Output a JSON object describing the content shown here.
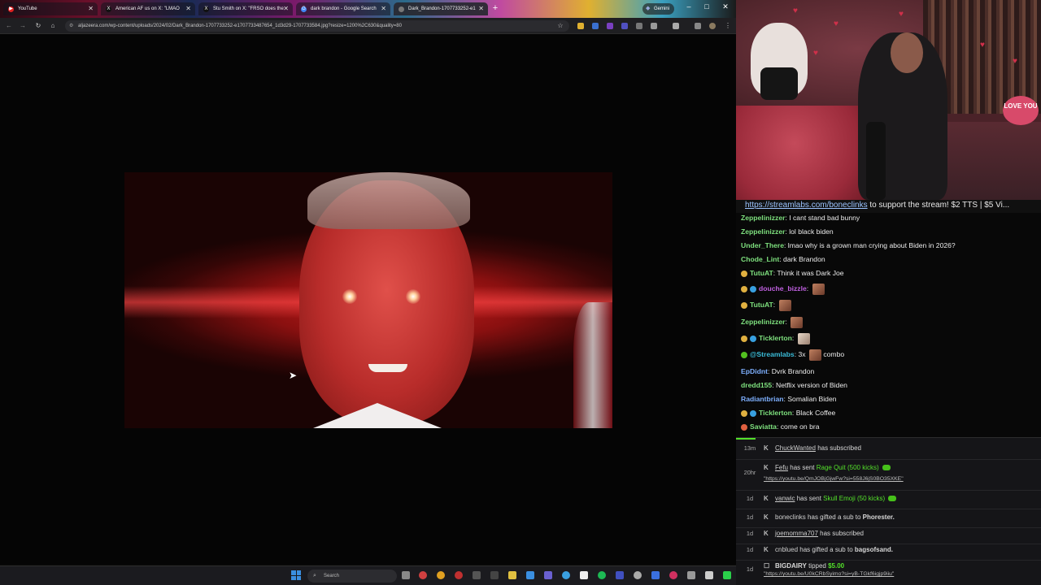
{
  "browser": {
    "tabs": [
      {
        "label": "YouTube",
        "icon": "youtube-icon",
        "color": "#e02020"
      },
      {
        "label": "American AF us on X: \"LMAO",
        "icon": "x-icon",
        "color": "#000000"
      },
      {
        "label": "Stu Smith on X: \"FRSO does the",
        "icon": "x-icon",
        "color": "#000000"
      },
      {
        "label": "dark brandon - Google Search",
        "icon": "google-icon",
        "color": "#4285f4"
      },
      {
        "label": "Dark_Brandon-1707733252-e1",
        "icon": "image-icon",
        "color": "#888888"
      }
    ],
    "new_tab": "+",
    "gemini": "Gemini",
    "win_controls": [
      "–",
      "□",
      "✕"
    ],
    "url": "aljazeera.com/wp-content/uploads/2024/02/Dark_Brandon-1707733252-e1707733487654_1d3d29-1707733584.jpg?resize=1200%2C630&quality=80",
    "nav": [
      "←",
      "→",
      "↻",
      "⌂"
    ],
    "star": "☆"
  },
  "taskbar": {
    "search_placeholder": "Search"
  },
  "webcam": {
    "sign_text": "LOVE YOU"
  },
  "banner": {
    "link": "https://streamlabs.com/boneclinks",
    "text": " to support the stream! $2 TTS | $5 Vi..."
  },
  "chat": [
    {
      "user": "Zeppelinizzer",
      "color": "#7ee07e",
      "text": "I cant stand bad bunny",
      "badges": []
    },
    {
      "user": "Zeppelinizzer",
      "color": "#7ee07e",
      "text": "lol black biden",
      "badges": []
    },
    {
      "user": "Under_There",
      "color": "#7ee07e",
      "text": "lmao why is a grown man crying about Biden in 2026?",
      "badges": []
    },
    {
      "user": "Chode_Lint",
      "color": "#7ee07e",
      "text": "dark Brandon",
      "badges": []
    },
    {
      "user": "TutuAT",
      "color": "#7ee07e",
      "text": "Think it was Dark Joe",
      "badges": [
        "#e0b040"
      ]
    },
    {
      "user": "douche_bizzle",
      "color": "#c060e0",
      "text": "",
      "badges": [
        "#e0b040",
        "#38a0e0"
      ],
      "emote": true
    },
    {
      "user": "TutuAT",
      "color": "#7ee07e",
      "text": "",
      "badges": [
        "#e0b040"
      ],
      "emote": true
    },
    {
      "user": "Zeppelinizzer",
      "color": "#7ee07e",
      "text": "",
      "badges": [],
      "emote": true
    },
    {
      "user": "Ticklerton",
      "color": "#7ee07e",
      "text": "",
      "badges": [
        "#e0b040",
        "#38a0e0"
      ],
      "emote": true
    },
    {
      "user": "@Streamlabs",
      "color": "#3abcd8",
      "text": "3x",
      "badges": [
        "#53c020"
      ],
      "emote": true,
      "suffix": "combo"
    },
    {
      "user": "EpDidnt",
      "color": "#7eb0ff",
      "text": "Dvrk Brandon",
      "badges": []
    },
    {
      "user": "dredd155",
      "color": "#7ee07e",
      "text": "Netflix version of Biden",
      "badges": []
    },
    {
      "user": "Radiantbrian",
      "color": "#7eb0ff",
      "text": "Somalian Biden",
      "badges": []
    },
    {
      "user": "Ticklerton",
      "color": "#7ee07e",
      "text": "Black Coffee",
      "badges": [
        "#e0b040",
        "#38a0e0"
      ]
    },
    {
      "user": "Saviatta",
      "color": "#7ee07e",
      "text": "come on bra",
      "badges": [
        "#e06040"
      ]
    }
  ],
  "events": [
    {
      "time": "13m",
      "name": "ChuckWanted",
      "text": "has subscribed",
      "gift": "",
      "link": "",
      "money": ""
    },
    {
      "time": "20hr",
      "name": "Fefu",
      "text": "has sent",
      "gift": "Rage Quit (500 kicks)",
      "link": "\"https://youtu.be/QmJOBjGjwFw?si=558J6jS0BO35XKE\"",
      "money": ""
    },
    {
      "time": "1d",
      "name": "vanwic",
      "text": "has sent",
      "gift": "Skull Emoji (50 kicks)",
      "link": "",
      "money": ""
    },
    {
      "time": "1d",
      "name": "boneclinks",
      "text": "has gifted a sub to",
      "gift": "",
      "target": "Phorester.",
      "link": "",
      "money": ""
    },
    {
      "time": "1d",
      "name": "joemomma707",
      "text": "has subscribed",
      "gift": "",
      "link": "",
      "money": ""
    },
    {
      "time": "1d",
      "name": "cnblued",
      "text": "has gifted a sub to",
      "gift": "",
      "target": "bagsofsand.",
      "link": "",
      "money": ""
    },
    {
      "time": "1d",
      "name": "BIGDAIRY",
      "text": "tipped",
      "gift": "",
      "link": "\"https://youtu.be/U0kCRbSyimo?si=yB-TGkf6igjp9iiu\"",
      "money": "$5.00"
    }
  ],
  "colors": {
    "kick_green": "#53e02a",
    "chat_bg": "#080808",
    "events_bg": "#151518"
  }
}
